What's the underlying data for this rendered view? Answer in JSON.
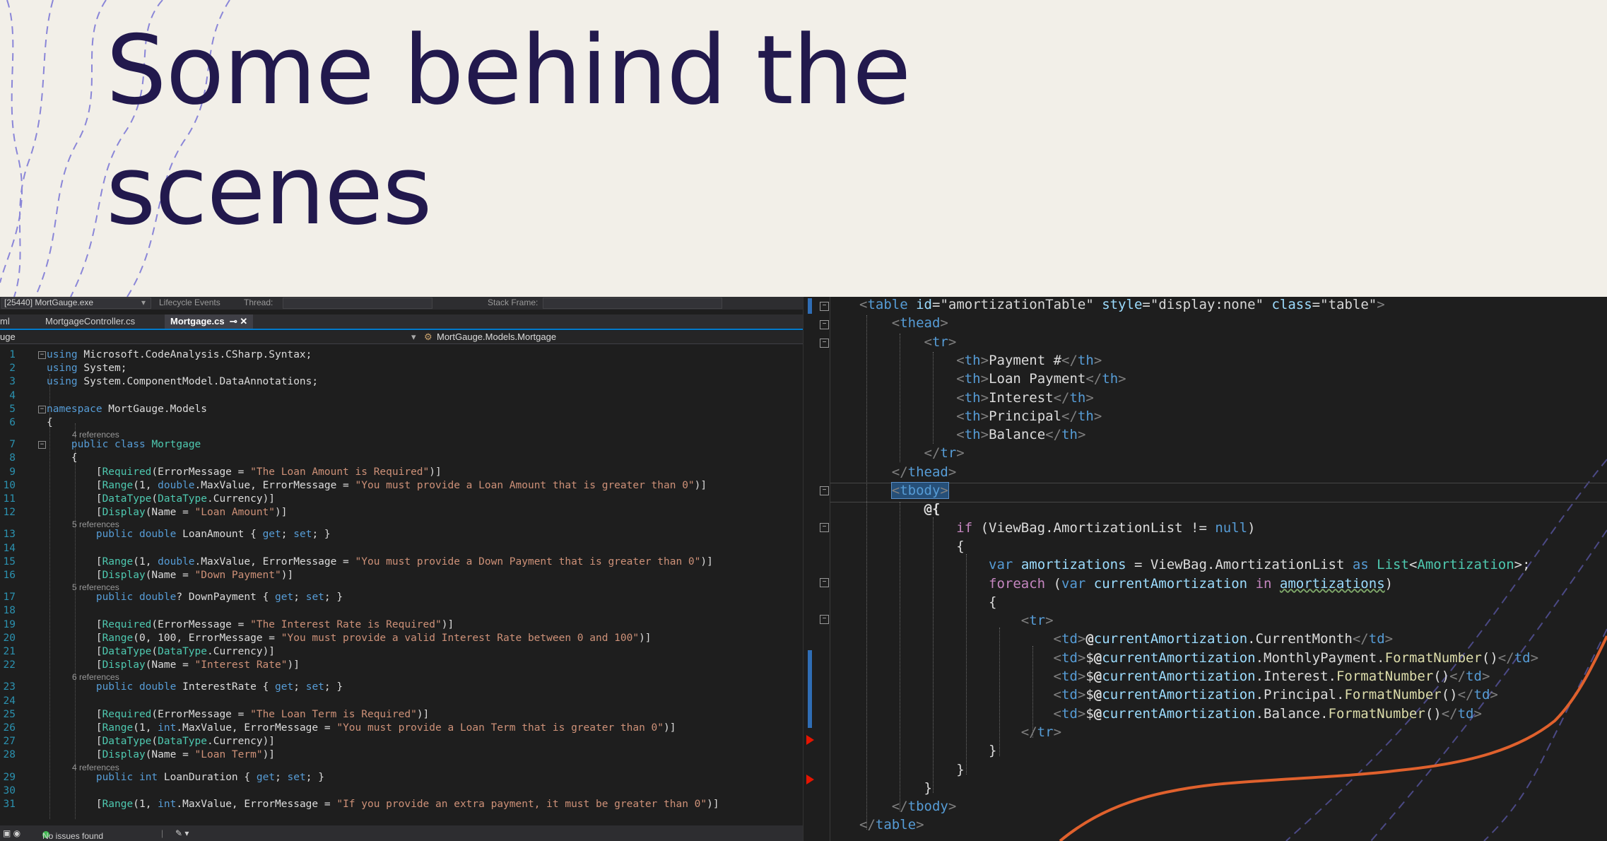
{
  "slide": {
    "title_line1": "Some behind the",
    "title_line2": "scenes"
  },
  "colors": {
    "title": "#22194d",
    "background": "#f2efe8",
    "editor_background": "#1e1e1e",
    "accent_line": "#e0612d",
    "decor_dash": "#8a86d8"
  },
  "left_editor": {
    "toolbar": {
      "process": "[25440] MortGauge.exe",
      "lifecycle": "Lifecycle Events",
      "thread": "Thread:",
      "stack_frame": "Stack Frame:"
    },
    "tabs": {
      "tab1": "ml",
      "tab2": "MortgageController.cs",
      "tab3": "Mortgage.cs"
    },
    "nav": {
      "project": "uge",
      "class_path": "MortGauge.Models.Mortgage"
    },
    "lines": [
      {
        "n": "1",
        "t": "using Microsoft.CodeAnalysis.CSharp.Syntax;"
      },
      {
        "n": "2",
        "t": "using System;"
      },
      {
        "n": "3",
        "t": "using System.ComponentModel.DataAnnotations;"
      },
      {
        "n": "4",
        "t": ""
      },
      {
        "n": "5",
        "t": "namespace MortGauge.Models"
      },
      {
        "n": "6",
        "t": "{"
      },
      {
        "ref": "4 references"
      },
      {
        "n": "7",
        "t": "    public class Mortgage"
      },
      {
        "n": "8",
        "t": "    {"
      },
      {
        "n": "9",
        "t": "        [Required(ErrorMessage = \"The Loan Amount is Required\")]"
      },
      {
        "n": "10",
        "t": "        [Range(1, double.MaxValue, ErrorMessage = \"You must provide a Loan Amount that is greater than 0\")]"
      },
      {
        "n": "11",
        "t": "        [DataType(DataType.Currency)]"
      },
      {
        "n": "12",
        "t": "        [Display(Name = \"Loan Amount\")]"
      },
      {
        "ref": "5 references"
      },
      {
        "n": "13",
        "t": "        public double LoanAmount { get; set; }"
      },
      {
        "n": "14",
        "t": ""
      },
      {
        "n": "15",
        "t": "        [Range(1, double.MaxValue, ErrorMessage = \"You must provide a Down Payment that is greater than 0\")]"
      },
      {
        "n": "16",
        "t": "        [Display(Name = \"Down Payment\")]"
      },
      {
        "ref": "5 references"
      },
      {
        "n": "17",
        "t": "        public double? DownPayment { get; set; }"
      },
      {
        "n": "18",
        "t": ""
      },
      {
        "n": "19",
        "t": "        [Required(ErrorMessage = \"The Interest Rate is Required\")]"
      },
      {
        "n": "20",
        "t": "        [Range(0, 100, ErrorMessage = \"You must provide a valid Interest Rate between 0 and 100\")]"
      },
      {
        "n": "21",
        "t": "        [DataType(DataType.Currency)]"
      },
      {
        "n": "22",
        "t": "        [Display(Name = \"Interest Rate\")]"
      },
      {
        "ref": "6 references"
      },
      {
        "n": "23",
        "t": "        public double InterestRate { get; set; }"
      },
      {
        "n": "24",
        "t": ""
      },
      {
        "n": "25",
        "t": "        [Required(ErrorMessage = \"The Loan Term is Required\")]"
      },
      {
        "n": "26",
        "t": "        [Range(1, int.MaxValue, ErrorMessage = \"You must provide a Loan Term that is greater than 0\")]"
      },
      {
        "n": "27",
        "t": "        [DataType(DataType.Currency)]"
      },
      {
        "n": "28",
        "t": "        [Display(Name = \"Loan Term\")]"
      },
      {
        "ref": "4 references"
      },
      {
        "n": "29",
        "t": "        public int LoanDuration { get; set; }"
      },
      {
        "n": "30",
        "t": ""
      },
      {
        "n": "31",
        "t": "        [Range(1, int.MaxValue, ErrorMessage = \"If you provide an extra payment, it must be greater than 0\")]"
      }
    ],
    "status": {
      "issues": "No issues found"
    }
  },
  "right_editor": {
    "lines": [
      "<table id=\"amortizationTable\" style=\"display:none\" class=\"table\">",
      "    <thead>",
      "        <tr>",
      "            <th>Payment #</th>",
      "            <th>Loan Payment</th>",
      "            <th>Interest</th>",
      "            <th>Principal</th>",
      "            <th>Balance</th>",
      "        </tr>",
      "    </thead>",
      "    <tbody>",
      "        @{",
      "            if (ViewBag.AmortizationList != null)",
      "            {",
      "                var amortizations = ViewBag.AmortizationList as List<Amortization>;",
      "                foreach (var currentAmortization in amortizations)",
      "                {",
      "                    <tr>",
      "                        <td>@currentAmortization.CurrentMonth</td>",
      "                        <td>$@currentAmortization.MonthlyPayment.FormatNumber()</td>",
      "                        <td>$@currentAmortization.Interest.FormatNumber()</td>",
      "                        <td>$@currentAmortization.Principal.FormatNumber()</td>",
      "                        <td>$@currentAmortization.Balance.FormatNumber()</td>",
      "                    </tr>",
      "                }",
      "            }",
      "        }",
      "    </tbody>",
      "</table>"
    ]
  }
}
